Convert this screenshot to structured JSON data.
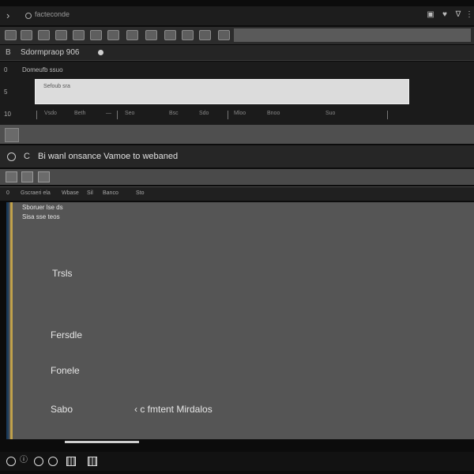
{
  "titlebar": {
    "title": "facteconde",
    "icons": [
      "square-icon",
      "heart-icon",
      "vee-icon",
      "ellipsis-icon"
    ]
  },
  "toolbar": {
    "tools": [
      "tool-1",
      "tool-2",
      "tool-3",
      "tool-4",
      "tool-5",
      "tool-6",
      "tool-7",
      "tool-8",
      "tool-9",
      "tool-10",
      "tool-11",
      "tool-12",
      "tool-13"
    ]
  },
  "header": {
    "text": "Sdormpraop 906"
  },
  "panel": {
    "gutter": [
      "0",
      "5",
      "10"
    ],
    "label": "Domeufb ssuo",
    "search_placeholder": "Sefoub sra",
    "columns": [
      "Vsdo",
      "Beth",
      "—",
      "Seo",
      "Bsc",
      "Sdo",
      "Mloo",
      "Bnoo",
      "Suo"
    ]
  },
  "message": {
    "radio": "C",
    "text": "Bi wanl onsance Vamoe to webaned"
  },
  "tabs": [
    "Gscraeri ela",
    "Wbase",
    "Sil",
    "Banco",
    "Sto"
  ],
  "main": {
    "header1": "Sboruer lse ds",
    "header2": "Sisa sse teos",
    "labels": {
      "thr": "Trsls",
      "p1": "Fersdle",
      "p2": "Fonele",
      "s": "Sabo",
      "note": "‹ c fmtent Mirdalos"
    }
  },
  "status": {
    "icons": [
      "circle-icon",
      "info-icon",
      "circle-icon",
      "circle-icon",
      "grid-icon",
      "grid-icon"
    ]
  },
  "colors": {
    "accent_gold": "#c1a24b",
    "accent_blue": "#1b3b5a",
    "panel_gray": "#555555",
    "dark_bg": "#1b1b1b"
  }
}
